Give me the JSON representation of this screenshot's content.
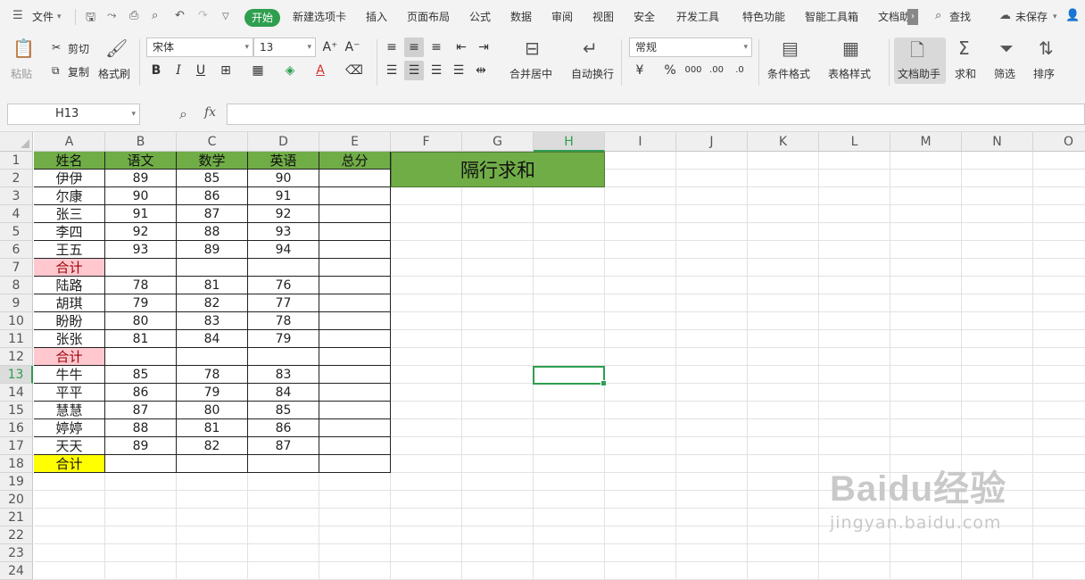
{
  "menubar": {
    "file": "文件",
    "tabs": [
      "开始",
      "新建选项卡",
      "插入",
      "页面布局",
      "公式",
      "数据",
      "审阅",
      "视图",
      "安全",
      "开发工具",
      "特色功能",
      "智能工具箱",
      "文档助"
    ],
    "search": "查找",
    "save_status": "未保存"
  },
  "ribbon": {
    "paste": "粘贴",
    "cut": "剪切",
    "copy": "复制",
    "format_painter": "格式刷",
    "font_name": "宋体",
    "font_size": "13",
    "merge_center": "合并居中",
    "auto_wrap": "自动换行",
    "number_format": "常规",
    "conditional_format": "条件格式",
    "table_style": "表格样式",
    "doc_assistant": "文档助手",
    "sum": "求和",
    "filter": "筛选",
    "sort": "排序",
    "bold": "B",
    "italic": "I",
    "underline": "U"
  },
  "formula_bar": {
    "name_box": "H13",
    "fx": "fx",
    "formula": ""
  },
  "sheet": {
    "columns": [
      "A",
      "B",
      "C",
      "D",
      "E",
      "F",
      "G",
      "H",
      "I",
      "J",
      "K",
      "L",
      "M",
      "N",
      "O"
    ],
    "rows": [
      "1",
      "2",
      "3",
      "4",
      "5",
      "6",
      "7",
      "8",
      "9",
      "10",
      "11",
      "12",
      "13",
      "14",
      "15",
      "16",
      "17",
      "18",
      "19",
      "20",
      "21",
      "22",
      "23",
      "24"
    ],
    "header": [
      "姓名",
      "语文",
      "数学",
      "英语",
      "总分"
    ],
    "data": [
      [
        "伊伊",
        "89",
        "85",
        "90",
        ""
      ],
      [
        "尔康",
        "90",
        "86",
        "91",
        ""
      ],
      [
        "张三",
        "91",
        "87",
        "92",
        ""
      ],
      [
        "李四",
        "92",
        "88",
        "93",
        ""
      ],
      [
        "王五",
        "93",
        "89",
        "94",
        ""
      ],
      [
        "合计",
        "",
        "",
        "",
        ""
      ],
      [
        "陆路",
        "78",
        "81",
        "76",
        ""
      ],
      [
        "胡琪",
        "79",
        "82",
        "77",
        ""
      ],
      [
        "盼盼",
        "80",
        "83",
        "78",
        ""
      ],
      [
        "张张",
        "81",
        "84",
        "79",
        ""
      ],
      [
        "合计",
        "",
        "",
        "",
        ""
      ],
      [
        "牛牛",
        "85",
        "78",
        "83",
        ""
      ],
      [
        "平平",
        "86",
        "79",
        "84",
        ""
      ],
      [
        "慧慧",
        "87",
        "80",
        "85",
        ""
      ],
      [
        "婷婷",
        "88",
        "81",
        "86",
        ""
      ],
      [
        "天天",
        "89",
        "82",
        "87",
        ""
      ],
      [
        "合计",
        "",
        "",
        "",
        ""
      ]
    ],
    "title_block": "隔行求和",
    "active_cell": "H13",
    "colors": {
      "header_fill": "#70ad47",
      "subtotal_fill": "#ffc7ce",
      "total_fill": "#ffff00",
      "accent": "#2e9e4f"
    }
  },
  "watermark": {
    "logo": "Baidu经验",
    "url": "jingyan.baidu.com"
  }
}
